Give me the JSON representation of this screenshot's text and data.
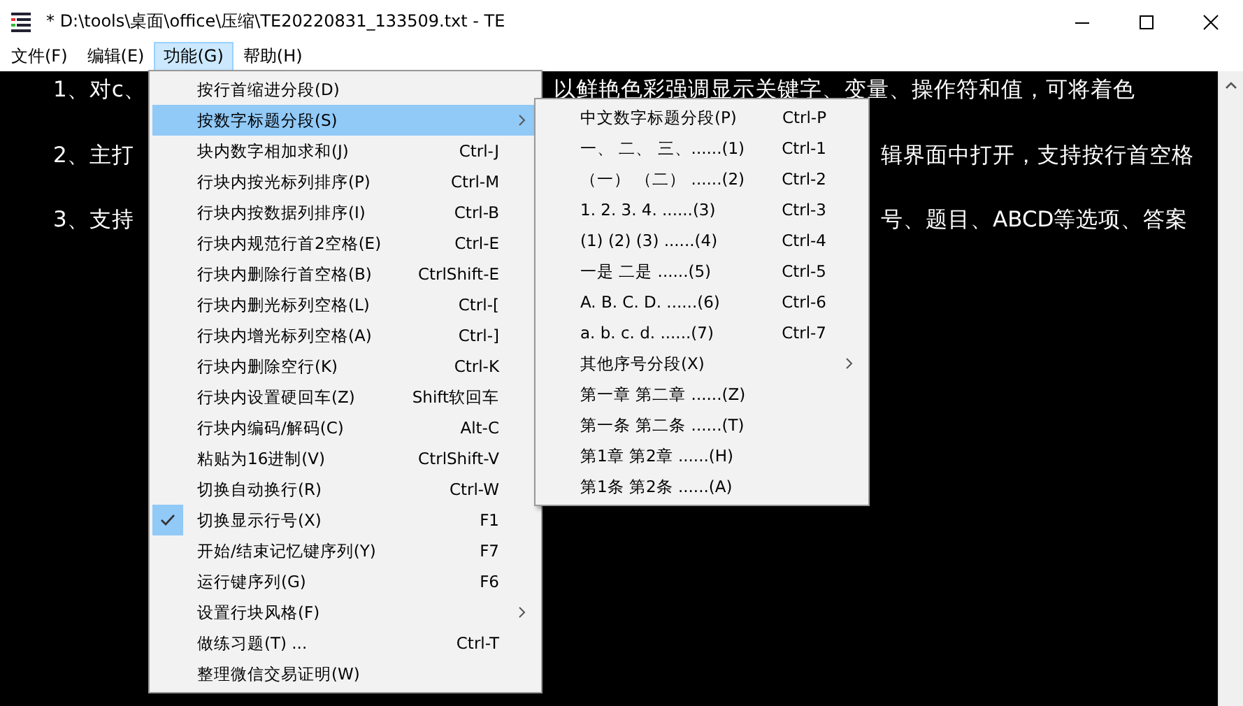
{
  "window": {
    "title": "* D:\\tools\\桌面\\office\\压缩\\TE20220831_133509.txt - TE"
  },
  "menu_bar": [
    {
      "label": "文件(F)",
      "selected": false
    },
    {
      "label": "编辑(E)",
      "selected": false
    },
    {
      "label": "功能(G)",
      "selected": true
    },
    {
      "label": "帮助(H)",
      "selected": false
    }
  ],
  "editor_lines": [
    {
      "left": "1、对c、",
      "right": "以鲜艳色彩强调显示关键字、变量、操作符和值，可将着色"
    },
    {
      "left": "2、主打",
      "right": "辑界面中打开，支持按行首空格"
    },
    {
      "left": "3、支持",
      "right": "号、题目、ABCD等选项、答案"
    }
  ],
  "menu": [
    {
      "label": "按行首缩进分段(D)",
      "submenu": false,
      "checked": false,
      "selected": false
    },
    {
      "label": "按数字标题分段(S)",
      "submenu": true,
      "checked": false,
      "selected": true
    },
    {
      "label": "块内数字相加求和(J)",
      "shortcut": "Ctrl-J",
      "submenu": false,
      "checked": false,
      "selected": false
    },
    {
      "label": "行块内按光标列排序(P)",
      "shortcut": "Ctrl-M",
      "submenu": false,
      "checked": false,
      "selected": false
    },
    {
      "label": "行块内按数据列排序(I)",
      "shortcut": "Ctrl-B",
      "submenu": false,
      "checked": false,
      "selected": false
    },
    {
      "label": "行块内规范行首2空格(E)",
      "shortcut": "Ctrl-E",
      "submenu": false,
      "checked": false,
      "selected": false
    },
    {
      "label": "行块内删除行首空格(B)",
      "shortcut": "CtrlShift-E",
      "submenu": false,
      "checked": false,
      "selected": false
    },
    {
      "label": "行块内删光标列空格(L)",
      "shortcut": "Ctrl-[",
      "submenu": false,
      "checked": false,
      "selected": false
    },
    {
      "label": "行块内增光标列空格(A)",
      "shortcut": "Ctrl-]",
      "submenu": false,
      "checked": false,
      "selected": false
    },
    {
      "label": "行块内删除空行(K)",
      "shortcut": "Ctrl-K",
      "submenu": false,
      "checked": false,
      "selected": false
    },
    {
      "label": "行块内设置硬回车(Z)",
      "shortcut": "Shift软回车",
      "submenu": false,
      "checked": false,
      "selected": false
    },
    {
      "label": "行块内编码/解码(C)",
      "shortcut": "Alt-C",
      "submenu": false,
      "checked": false,
      "selected": false
    },
    {
      "label": "粘贴为16进制(V)",
      "shortcut": "CtrlShift-V",
      "submenu": false,
      "checked": false,
      "selected": false
    },
    {
      "label": "切换自动换行(R)",
      "shortcut": "Ctrl-W",
      "submenu": false,
      "checked": false,
      "selected": false
    },
    {
      "label": "切换显示行号(X)",
      "shortcut": "F1",
      "submenu": false,
      "checked": true,
      "selected": false
    },
    {
      "label": "开始/结束记忆键序列(Y)",
      "shortcut": "F7",
      "submenu": false,
      "checked": false,
      "selected": false
    },
    {
      "label": "运行键序列(G)",
      "shortcut": "F6",
      "submenu": false,
      "checked": false,
      "selected": false
    },
    {
      "label": "设置行块风格(F)",
      "submenu": true,
      "checked": false,
      "selected": false
    },
    {
      "label": "做练习题(T) ...",
      "shortcut": "Ctrl-T",
      "submenu": false,
      "checked": false,
      "selected": false
    },
    {
      "label": "整理微信交易证明(W)",
      "submenu": false,
      "checked": false,
      "selected": false
    }
  ],
  "submenu": [
    {
      "label": "中文数字标题分段(P)",
      "shortcut": "Ctrl-P",
      "submenu": false
    },
    {
      "label": "一、 二、 三、......(1)",
      "shortcut": "Ctrl-1",
      "submenu": false
    },
    {
      "label": "（一） （二） ......(2)",
      "shortcut": "Ctrl-2",
      "submenu": false
    },
    {
      "label": "1. 2.  3.  4.  ......(3)",
      "shortcut": "Ctrl-3",
      "submenu": false
    },
    {
      "label": "(1)  (2)  (3)   ......(4)",
      "shortcut": "Ctrl-4",
      "submenu": false
    },
    {
      "label": "一是    二是     ......(5)",
      "shortcut": "Ctrl-5",
      "submenu": false
    },
    {
      "label": "A.  B.  C.  D.    ......(6)",
      "shortcut": "Ctrl-6",
      "submenu": false
    },
    {
      "label": "a.   b.   c.   d. ......(7)",
      "shortcut": "Ctrl-7",
      "submenu": false
    },
    {
      "label": "其他序号分段(X)",
      "submenu": true
    },
    {
      "label": "第一章 第二章 ......(Z)",
      "submenu": false
    },
    {
      "label": "第一条 第二条 ......(T)",
      "submenu": false
    },
    {
      "label": "第1章  第2章    ......(H)",
      "submenu": false
    },
    {
      "label": "第1条  第2条    ......(A)",
      "submenu": false
    }
  ]
}
